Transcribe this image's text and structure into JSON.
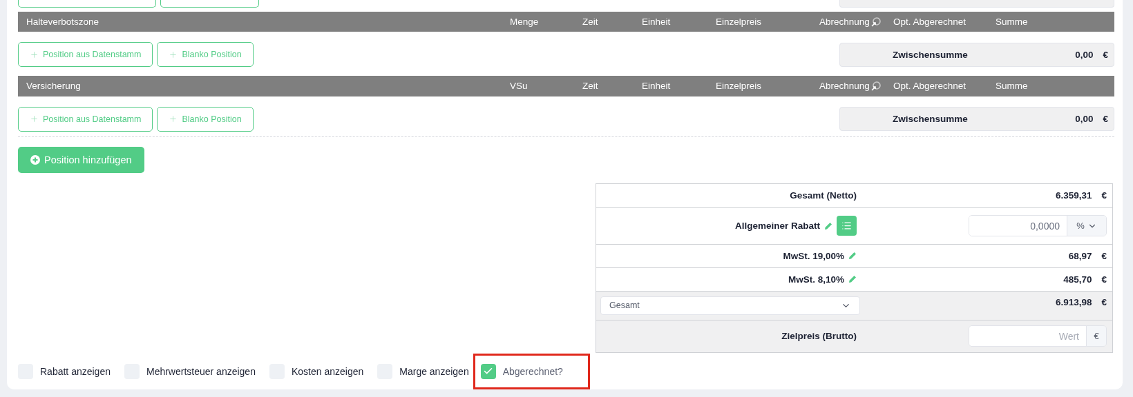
{
  "sections": [
    {
      "title": "Halteverbotszone",
      "columns": [
        "Menge",
        "Zeit",
        "Einheit",
        "Einzelpreis",
        "Abrechnung",
        "Opt. Abgerechnet",
        "Summe"
      ],
      "buttons": [
        "Position aus Datenstamm",
        "Blanko Position"
      ],
      "subtotal": {
        "label": "Zwischensumme",
        "value": "0,00",
        "currency": "€"
      }
    },
    {
      "title": "Versicherung",
      "columns": [
        "VSu",
        "Zeit",
        "Einheit",
        "Einzelpreis",
        "Abrechnung",
        "Opt. Abgerechnet",
        "Summe"
      ],
      "buttons": [
        "Position aus Datenstamm",
        "Blanko Position"
      ],
      "subtotal": {
        "label": "Zwischensumme",
        "value": "0,00",
        "currency": "€"
      }
    }
  ],
  "add_button": "Position hinzufügen",
  "totals": [
    {
      "kind": "sum",
      "label": "Gesamt (Netto)",
      "value": "6.359,31",
      "currency": "€"
    },
    {
      "kind": "discount",
      "label": "Allgemeiner Rabatt",
      "value": "0,0000",
      "unit": "%"
    },
    {
      "kind": "tax",
      "label": "MwSt. 19,00%",
      "value": "68,97",
      "currency": "€"
    },
    {
      "kind": "tax",
      "label": "MwSt. 8,10%",
      "value": "485,70",
      "currency": "€"
    },
    {
      "kind": "grand",
      "select": "Gesamt",
      "value": "6.913,98",
      "currency": "€"
    },
    {
      "kind": "target",
      "label": "Zielpreis (Brutto)",
      "placeholder": "Wert",
      "unit": "€"
    }
  ],
  "options": [
    {
      "label": "Rabatt anzeigen",
      "checked": false,
      "highlighted": false
    },
    {
      "label": "Mehrwertsteuer anzeigen",
      "checked": false,
      "highlighted": false
    },
    {
      "label": "Kosten anzeigen",
      "checked": false,
      "highlighted": false
    },
    {
      "label": "Marge anzeigen",
      "checked": false,
      "highlighted": false
    },
    {
      "label": "Abgerechnet?",
      "checked": true,
      "highlighted": true
    }
  ]
}
